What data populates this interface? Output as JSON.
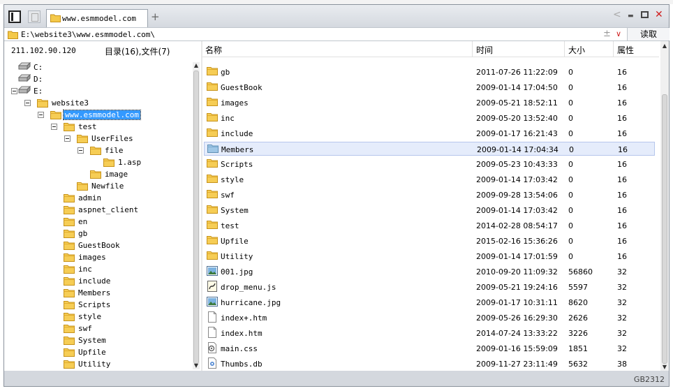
{
  "address": {
    "path": "E:\\website3\\www.esmmodel.com\\",
    "plus": "±",
    "read_label": "读取"
  },
  "tab": {
    "title": "www.esmmodel.com",
    "new_tab": "+"
  },
  "controls": {
    "back": "<",
    "minimize": "▬",
    "maximize": "□",
    "close": "✕"
  },
  "left_panel": {
    "ip": "211.102.90.120",
    "summary": "目录(16),文件(7)",
    "tree": [
      {
        "label": "C:",
        "depth": 0,
        "icon": "drive-icon",
        "expander": false
      },
      {
        "label": "D:",
        "depth": 0,
        "icon": "drive-icon",
        "expander": false
      },
      {
        "label": "E:",
        "depth": 0,
        "icon": "drive-icon",
        "expander": true
      },
      {
        "label": "website3",
        "depth": 1,
        "icon": "folder-icon",
        "expander": true
      },
      {
        "label": "www.esmmodel.com",
        "depth": 2,
        "icon": "folder-icon",
        "expander": true,
        "selected": true
      },
      {
        "label": "test",
        "depth": 3,
        "icon": "folder-icon",
        "expander": true
      },
      {
        "label": "UserFiles",
        "depth": 4,
        "icon": "folder-icon",
        "expander": true
      },
      {
        "label": "file",
        "depth": 5,
        "icon": "folder-icon",
        "expander": true
      },
      {
        "label": "1.asp",
        "depth": 6,
        "icon": "folder-icon",
        "expander": false
      },
      {
        "label": "image",
        "depth": 5,
        "icon": "folder-icon",
        "expander": false
      },
      {
        "label": "Newfile",
        "depth": 4,
        "icon": "folder-icon",
        "expander": false
      },
      {
        "label": "admin",
        "depth": 3,
        "icon": "folder-icon",
        "expander": false
      },
      {
        "label": "aspnet_client",
        "depth": 3,
        "icon": "folder-icon",
        "expander": false
      },
      {
        "label": "en",
        "depth": 3,
        "icon": "folder-icon",
        "expander": false
      },
      {
        "label": "gb",
        "depth": 3,
        "icon": "folder-icon",
        "expander": false
      },
      {
        "label": "GuestBook",
        "depth": 3,
        "icon": "folder-icon",
        "expander": false
      },
      {
        "label": "images",
        "depth": 3,
        "icon": "folder-icon",
        "expander": false
      },
      {
        "label": "inc",
        "depth": 3,
        "icon": "folder-icon",
        "expander": false
      },
      {
        "label": "include",
        "depth": 3,
        "icon": "folder-icon",
        "expander": false
      },
      {
        "label": "Members",
        "depth": 3,
        "icon": "folder-icon",
        "expander": false
      },
      {
        "label": "Scripts",
        "depth": 3,
        "icon": "folder-icon",
        "expander": false
      },
      {
        "label": "style",
        "depth": 3,
        "icon": "folder-icon",
        "expander": false
      },
      {
        "label": "swf",
        "depth": 3,
        "icon": "folder-icon",
        "expander": false
      },
      {
        "label": "System",
        "depth": 3,
        "icon": "folder-icon",
        "expander": false
      },
      {
        "label": "Upfile",
        "depth": 3,
        "icon": "folder-icon",
        "expander": false
      },
      {
        "label": "Utility",
        "depth": 3,
        "icon": "folder-icon",
        "expander": false
      }
    ]
  },
  "file_list": {
    "columns": {
      "name": "名称",
      "time": "时间",
      "size": "大小",
      "attr": "属性"
    },
    "rows": [
      {
        "name": "gb",
        "time": "2011-07-26 11:22:09",
        "size": "0",
        "attr": "16",
        "icon": "folder-icon"
      },
      {
        "name": "GuestBook",
        "time": "2009-01-14 17:04:50",
        "size": "0",
        "attr": "16",
        "icon": "folder-icon"
      },
      {
        "name": "images",
        "time": "2009-05-21 18:52:11",
        "size": "0",
        "attr": "16",
        "icon": "folder-icon"
      },
      {
        "name": "inc",
        "time": "2009-05-20 13:52:40",
        "size": "0",
        "attr": "16",
        "icon": "folder-icon"
      },
      {
        "name": "include",
        "time": "2009-01-17 16:21:43",
        "size": "0",
        "attr": "16",
        "icon": "folder-icon"
      },
      {
        "name": "Members",
        "time": "2009-01-14 17:04:34",
        "size": "0",
        "attr": "16",
        "icon": "folder-open-icon",
        "highlight": true
      },
      {
        "name": "Scripts",
        "time": "2009-05-23 10:43:33",
        "size": "0",
        "attr": "16",
        "icon": "folder-icon"
      },
      {
        "name": "style",
        "time": "2009-01-14 17:03:42",
        "size": "0",
        "attr": "16",
        "icon": "folder-icon"
      },
      {
        "name": "swf",
        "time": "2009-09-28 13:54:06",
        "size": "0",
        "attr": "16",
        "icon": "folder-icon"
      },
      {
        "name": "System",
        "time": "2009-01-14 17:03:42",
        "size": "0",
        "attr": "16",
        "icon": "folder-icon"
      },
      {
        "name": "test",
        "time": "2014-02-28 08:54:17",
        "size": "0",
        "attr": "16",
        "icon": "folder-icon"
      },
      {
        "name": "Upfile",
        "time": "2015-02-16 15:36:26",
        "size": "0",
        "attr": "16",
        "icon": "folder-icon"
      },
      {
        "name": "Utility",
        "time": "2009-01-14 17:01:59",
        "size": "0",
        "attr": "16",
        "icon": "folder-icon"
      },
      {
        "name": "001.jpg",
        "time": "2010-09-20 11:09:32",
        "size": "56860",
        "attr": "32",
        "icon": "image-file-icon"
      },
      {
        "name": "drop_menu.js",
        "time": "2009-05-21 19:24:16",
        "size": "5597",
        "attr": "32",
        "icon": "script-file-icon"
      },
      {
        "name": "hurricane.jpg",
        "time": "2009-01-17 10:31:11",
        "size": "8620",
        "attr": "32",
        "icon": "image-file-icon"
      },
      {
        "name": "index+.htm",
        "time": "2009-05-26 16:29:30",
        "size": "2626",
        "attr": "32",
        "icon": "blank-file-icon"
      },
      {
        "name": "index.htm",
        "time": "2014-07-24 13:33:22",
        "size": "3226",
        "attr": "32",
        "icon": "blank-file-icon"
      },
      {
        "name": "main.css",
        "time": "2009-01-16 15:59:09",
        "size": "1851",
        "attr": "32",
        "icon": "css-file-icon"
      },
      {
        "name": "Thumbs.db",
        "time": "2009-11-27 23:11:49",
        "size": "5632",
        "attr": "38",
        "icon": "db-file-icon"
      }
    ]
  },
  "status": {
    "encoding": "GB2312"
  },
  "colors": {
    "selection": "#3399ff",
    "row_highlight": "#e5ecfb",
    "close_red": "#d02020"
  }
}
